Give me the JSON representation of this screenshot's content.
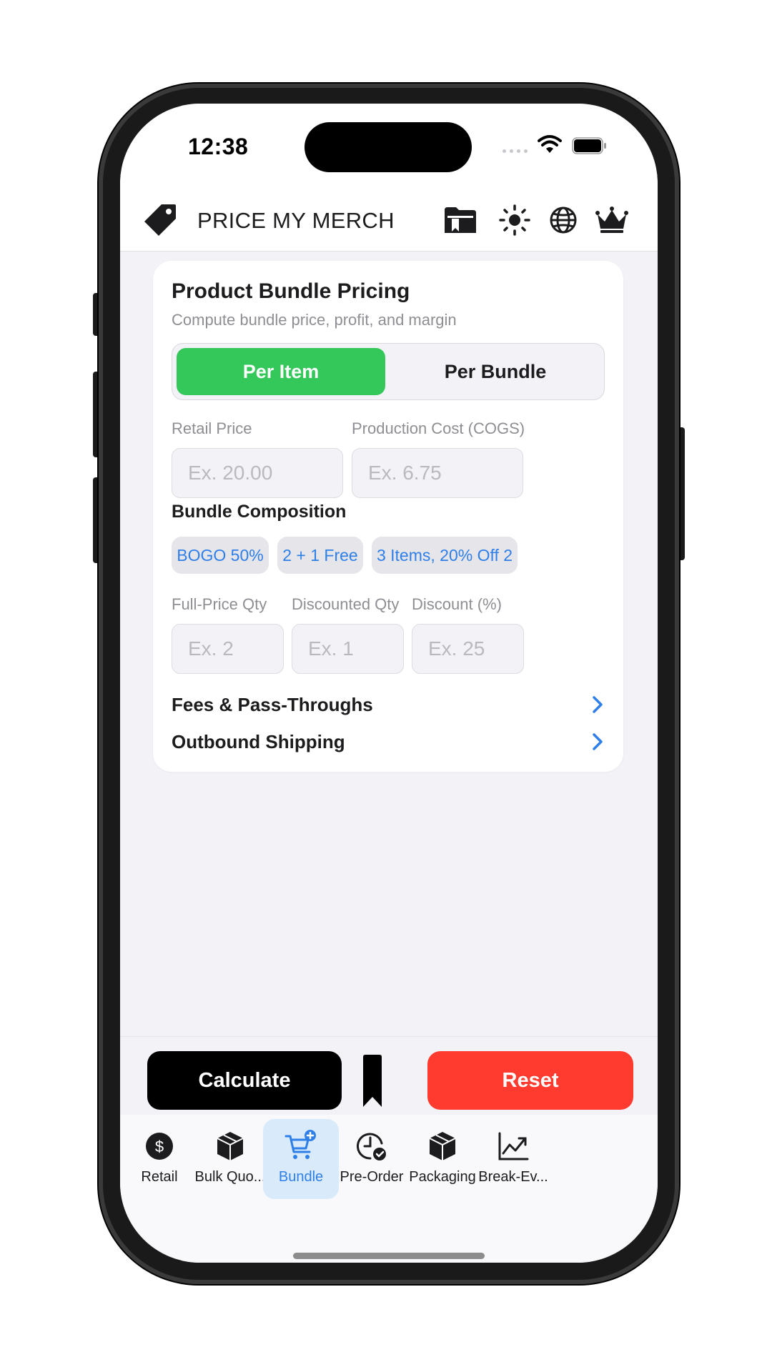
{
  "status_bar": {
    "time": "12:38"
  },
  "header": {
    "title": "PRICE MY MERCH"
  },
  "card": {
    "title": "Product Bundle Pricing",
    "subtitle": "Compute bundle price, profit, and margin",
    "segments": {
      "active": "Per Item",
      "inactive": "Per Bundle"
    },
    "retail_price": {
      "label": "Retail Price",
      "placeholder": "Ex. 20.00"
    },
    "cogs": {
      "label": "Production Cost (COGS)",
      "placeholder": "Ex. 6.75"
    },
    "composition_title": "Bundle Composition",
    "presets": [
      "BOGO 50%",
      "2 + 1 Free",
      "3 Items, 20% Off 2"
    ],
    "full_qty": {
      "label": "Full-Price Qty",
      "placeholder": "Ex. 2"
    },
    "disc_qty": {
      "label": "Discounted Qty",
      "placeholder": "Ex. 1"
    },
    "discount": {
      "label": "Discount (%)",
      "placeholder": "Ex. 25"
    },
    "fees_link": "Fees & Pass-Throughs",
    "shipping_link": "Outbound Shipping"
  },
  "actions": {
    "calculate": "Calculate",
    "reset": "Reset"
  },
  "tabs": [
    {
      "label": "Retail",
      "icon": "dollar-circle-icon"
    },
    {
      "label": "Bulk Quo...",
      "icon": "box-icon"
    },
    {
      "label": "Bundle",
      "icon": "cart-plus-icon",
      "active": true
    },
    {
      "label": "Pre-Order",
      "icon": "clock-check-icon"
    },
    {
      "label": "Packaging",
      "icon": "package-icon"
    },
    {
      "label": "Break-Ev...",
      "icon": "chart-up-icon"
    }
  ],
  "colors": {
    "accent": "#2f7fe8",
    "segment_active": "#34c759",
    "reset": "#ff3b30",
    "calculate": "#000000"
  }
}
